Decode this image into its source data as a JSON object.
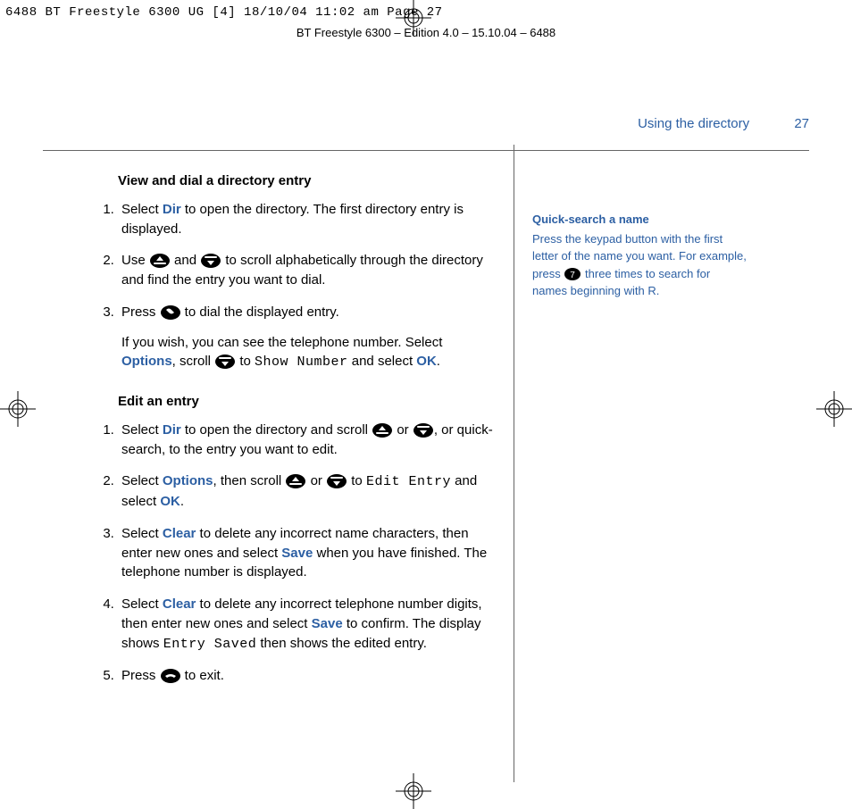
{
  "slug": "6488 BT Freestyle 6300 UG [4]  18/10/04  11:02 am  Page 27",
  "edition_line": "BT Freestyle 6300 – Edition 4.0 – 15.10.04 – 6488",
  "header": {
    "section": "Using the directory",
    "page_number": "27"
  },
  "section1": {
    "heading": "View and dial a directory entry",
    "s1a": "Select ",
    "s1b": " to open the directory. The first directory entry is displayed.",
    "s2a": "Use ",
    "s2b": " and ",
    "s2c": " to scroll alphabetically through the directory and find the entry you want to dial.",
    "s3a": "Press ",
    "s3b": " to dial the displayed entry.",
    "s3c_a": "If you wish, you can see the telephone number. Select ",
    "s3c_b": ", scroll ",
    "s3c_c": " to ",
    "s3c_lcd": "Show Number",
    "s3c_d": " and select ",
    "s3c_e": "."
  },
  "section2": {
    "heading": "Edit an entry",
    "s1a": "Select ",
    "s1b": " to open the directory and scroll ",
    "s1c": " or ",
    "s1d": ", or quick-search, to the entry you want to edit.",
    "s2a": "Select ",
    "s2b": ", then scroll ",
    "s2c": " or ",
    "s2d": " to ",
    "s2lcd": "Edit Entry",
    "s2e": " and select ",
    "s2f": ".",
    "s3a": "Select ",
    "s3b": " to delete any incorrect name characters, then enter new ones and select ",
    "s3c": " when you have finished. The telephone number is displayed.",
    "s4a": "Select ",
    "s4b": " to delete any incorrect telephone number digits, then enter new ones and select ",
    "s4c": " to confirm. The display shows ",
    "s4lcd": "Entry Saved",
    "s4d": " then shows the edited entry.",
    "s5a": "Press ",
    "s5b": " to exit."
  },
  "kw": {
    "Dir": "Dir",
    "Options": "Options",
    "OK": "OK",
    "Clear": "Clear",
    "Save": "Save"
  },
  "tip": {
    "heading": "Quick-search a name",
    "t1": "Press the keypad button with the first letter of the name you want. For example, press ",
    "key": "7",
    "t2": " three times to search for names beginning with R."
  }
}
